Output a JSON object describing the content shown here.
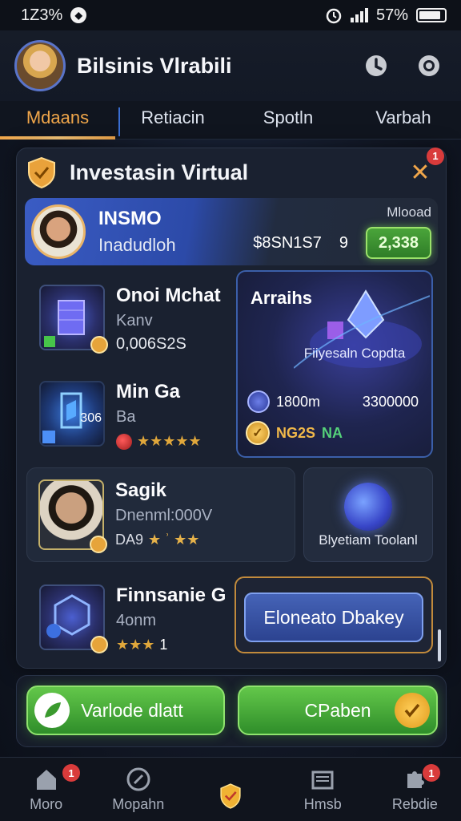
{
  "status_bar": {
    "time": "1Z3%",
    "battery": "57%"
  },
  "header": {
    "title": "Bilsinis Vlrabili"
  },
  "tabs": [
    {
      "label": "Mdaans",
      "active": true
    },
    {
      "label": "Retiacin",
      "active": false
    },
    {
      "label": "Spotln",
      "active": false
    },
    {
      "label": "Varbah",
      "active": false
    }
  ],
  "panel": {
    "title": "Investasin Virtual",
    "close_badge": "1",
    "profile": {
      "name": "INSMO",
      "subtitle": "Inadudloh",
      "label": "Mlooad",
      "amount": "$8SN1S7",
      "count": "9",
      "badge": "2,338"
    },
    "items": [
      {
        "name": "Onoi Mchat",
        "sub": "Kanv",
        "value": "0,006S2S"
      },
      {
        "name": "Min Ga",
        "sub": "Ba",
        "extra": "306",
        "stars": "★★★★★"
      }
    ],
    "feature": {
      "title": "Arraihs",
      "caption": "Fiiyesaln Copdta",
      "left_value": "1800m",
      "right_value": "3300000",
      "status_label": "NG2S",
      "status_ok": "NA"
    },
    "card_person": {
      "name": "Sagik",
      "sub": "Dnenml:000V",
      "rating_label": "DA9",
      "stars": "★ ʾ ★★"
    },
    "tool_card": {
      "caption": "Blyetiam Toolanl"
    },
    "card_item3": {
      "name": "Finnsanie G",
      "sub": "4onm",
      "stars": "★★★",
      "count": "1"
    },
    "cta": {
      "label": "Elonеato Dbakey"
    }
  },
  "actions": {
    "left": "Varlode dlatt",
    "right": "CPaben"
  },
  "bottom_nav": [
    {
      "label": "Moro",
      "badge": "1"
    },
    {
      "label": "Mopahn"
    },
    {
      "label": ""
    },
    {
      "label": "Hmsb"
    },
    {
      "label": "Rebdie",
      "badge": "1"
    }
  ],
  "colors": {
    "accent": "#f0a64a",
    "green": "#4fb33d",
    "blue": "#3a5cc4",
    "bg": "#121826"
  }
}
